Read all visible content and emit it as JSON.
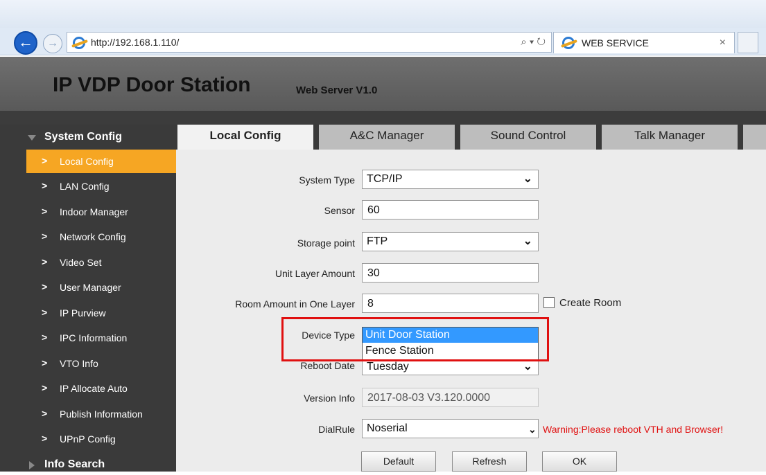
{
  "browser": {
    "url": "http://192.168.1.110/",
    "tab_title": "WEB SERVICE",
    "tab_close": "×",
    "addr_tools": "⌕ ▾ ↻"
  },
  "header": {
    "title": "IP VDP Door Station",
    "subtitle": "Web Server V1.0"
  },
  "sidebar": {
    "section": "System Config",
    "items": [
      {
        "label": "Local Config"
      },
      {
        "label": "LAN Config"
      },
      {
        "label": "Indoor Manager"
      },
      {
        "label": "Network Config"
      },
      {
        "label": "Video Set"
      },
      {
        "label": "User Manager"
      },
      {
        "label": "IP Purview"
      },
      {
        "label": "IPC Information"
      },
      {
        "label": "VTO Info"
      },
      {
        "label": "IP Allocate Auto"
      },
      {
        "label": "Publish Information"
      },
      {
        "label": "UPnP Config"
      }
    ],
    "footer_section": "Info Search"
  },
  "tabs": [
    "Local Config",
    "A&C Manager",
    "Sound Control",
    "Talk Manager"
  ],
  "form": {
    "system_type": {
      "label": "System Type",
      "value": "TCP/IP"
    },
    "sensor": {
      "label": "Sensor",
      "value": "60"
    },
    "storage_point": {
      "label": "Storage point",
      "value": "FTP"
    },
    "unit_layer_amount": {
      "label": "Unit Layer Amount",
      "value": "30"
    },
    "room_amount": {
      "label": "Room Amount in One Layer",
      "value": "8"
    },
    "create_room": {
      "label": "Create Room"
    },
    "device_type": {
      "label": "Device Type",
      "options": [
        "Unit Door Station",
        "Fence Station"
      ]
    },
    "reboot_date": {
      "label": "Reboot Date",
      "value": "Tuesday"
    },
    "version_info": {
      "label": "Version Info",
      "value": "2017-08-03 V3.120.0000"
    },
    "dial_rule": {
      "label": "DialRule",
      "value": "Noserial"
    },
    "warning": "Warning:Please reboot VTH and Browser!"
  },
  "buttons": {
    "default": "Default",
    "refresh": "Refresh",
    "ok": "OK"
  },
  "colors": {
    "active_item": "#f6a623",
    "highlight_box": "#e01010",
    "selected_option": "#3399ff"
  }
}
